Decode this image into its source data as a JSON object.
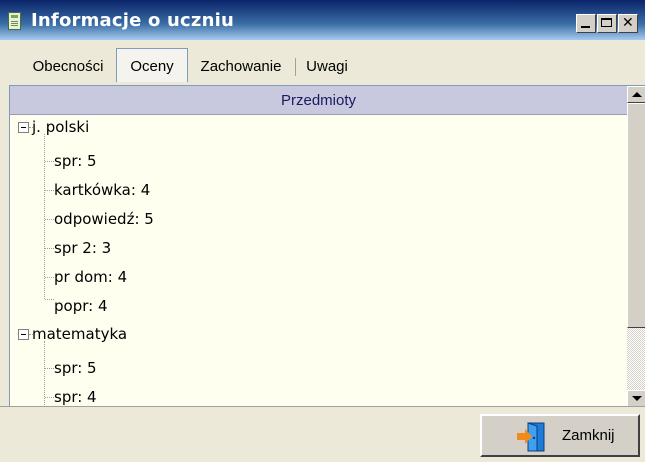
{
  "window": {
    "title": "Informacje o uczniu"
  },
  "tabs": [
    {
      "label": "Obecności",
      "selected": false
    },
    {
      "label": "Oceny",
      "selected": true
    },
    {
      "label": "Zachowanie",
      "selected": false
    },
    {
      "label": "Uwagi",
      "selected": false
    }
  ],
  "grid": {
    "header": "Przedmioty"
  },
  "subjects": [
    {
      "name": "j. polski",
      "expanded": true,
      "grades": [
        "spr: 5",
        "kartkówka: 4",
        "odpowiedź: 5",
        "spr 2: 3",
        "pr dom: 4",
        "popr: 4"
      ]
    },
    {
      "name": "matematyka",
      "expanded": true,
      "grades": [
        "spr: 5",
        "spr: 4"
      ]
    }
  ],
  "buttons": {
    "close_label": "Zamknij"
  },
  "colors": {
    "content_bg": "#fffff0",
    "header_bg": "#c8c9df",
    "title_bar": "#0a246a"
  }
}
